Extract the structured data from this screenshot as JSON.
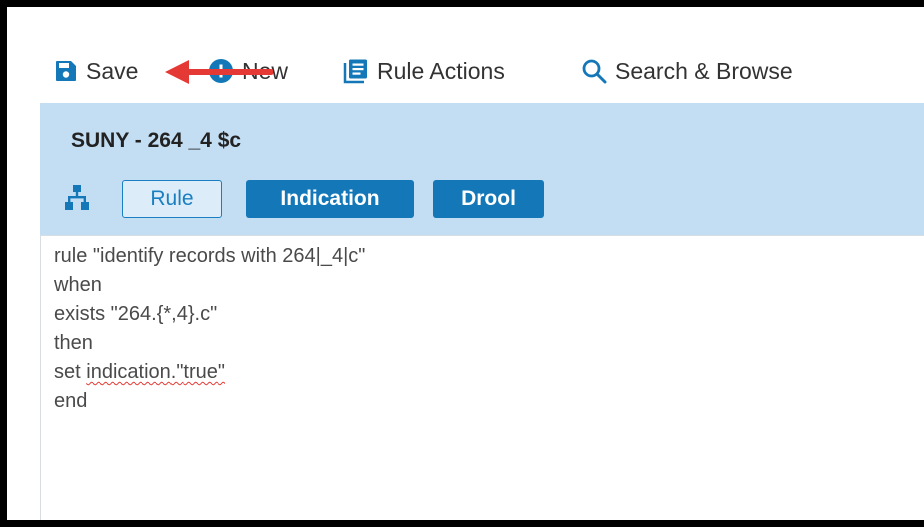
{
  "toolbar": {
    "save_label": "Save",
    "new_label": "New",
    "rule_actions_label": "Rule Actions",
    "search_label": "Search & Browse"
  },
  "rule": {
    "title": "SUNY - 264 _4 $c",
    "tabs": {
      "rule": "Rule",
      "indication": "Indication",
      "drool": "Drool"
    }
  },
  "code": {
    "line1": "rule \"identify records with 264|_4|c\"",
    "line2": "when",
    "line3": "exists \"264.{*,4}.c\"",
    "line4": "then",
    "line5_prefix": "set ",
    "line5_word1": "indication",
    "line5_sep": ".\"",
    "line5_word2": "true",
    "line5_suffix": "\"",
    "line6": "end"
  },
  "colors": {
    "accent": "#1478b8",
    "panel": "#c3ddf3",
    "annotation_arrow": "#e53935"
  },
  "icons": {
    "save": "save-icon",
    "new": "plus-circle-icon",
    "rule_actions": "list-document-icon",
    "search": "search-icon",
    "hierarchy": "hierarchy-icon"
  }
}
